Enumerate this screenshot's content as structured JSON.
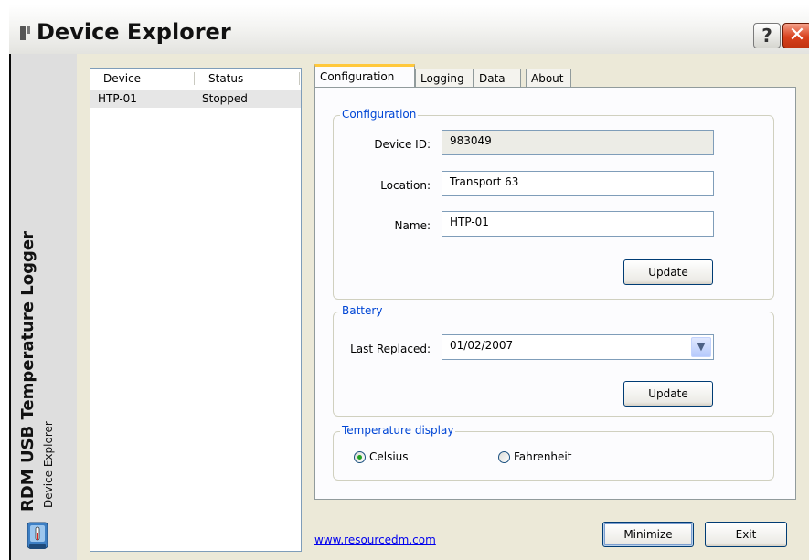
{
  "window": {
    "title": "Device Explorer",
    "help_glyph": "?",
    "close_glyph": "✕"
  },
  "sidebar": {
    "title": "RDM USB Temperature Logger",
    "subtitle": "Device Explorer"
  },
  "device_list": {
    "columns": [
      "Device",
      "Status"
    ],
    "rows": [
      {
        "device": "HTP-01",
        "status": "Stopped"
      }
    ]
  },
  "tabs": [
    "Configuration",
    "Logging",
    "Data",
    "About"
  ],
  "configuration_group": {
    "legend": "Configuration",
    "device_id_label": "Device ID:",
    "device_id_value": "983049",
    "location_label": "Location:",
    "location_value": "Transport 63",
    "name_label": "Name:",
    "name_value": "HTP-01",
    "update_label": "Update"
  },
  "battery_group": {
    "legend": "Battery",
    "last_replaced_label": "Last Replaced:",
    "last_replaced_value": "01/02/2007",
    "update_label": "Update"
  },
  "temperature_group": {
    "legend": "Temperature display",
    "options": [
      "Celsius",
      "Fahrenheit"
    ],
    "selected": "Celsius"
  },
  "footer": {
    "link": "www.resourcedm.com",
    "minimize_label": "Minimize",
    "exit_label": "Exit"
  },
  "colors": {
    "group_legend": "#0046d5",
    "tab_highlight": "#ffc83c",
    "close_button": "#d8401c"
  }
}
